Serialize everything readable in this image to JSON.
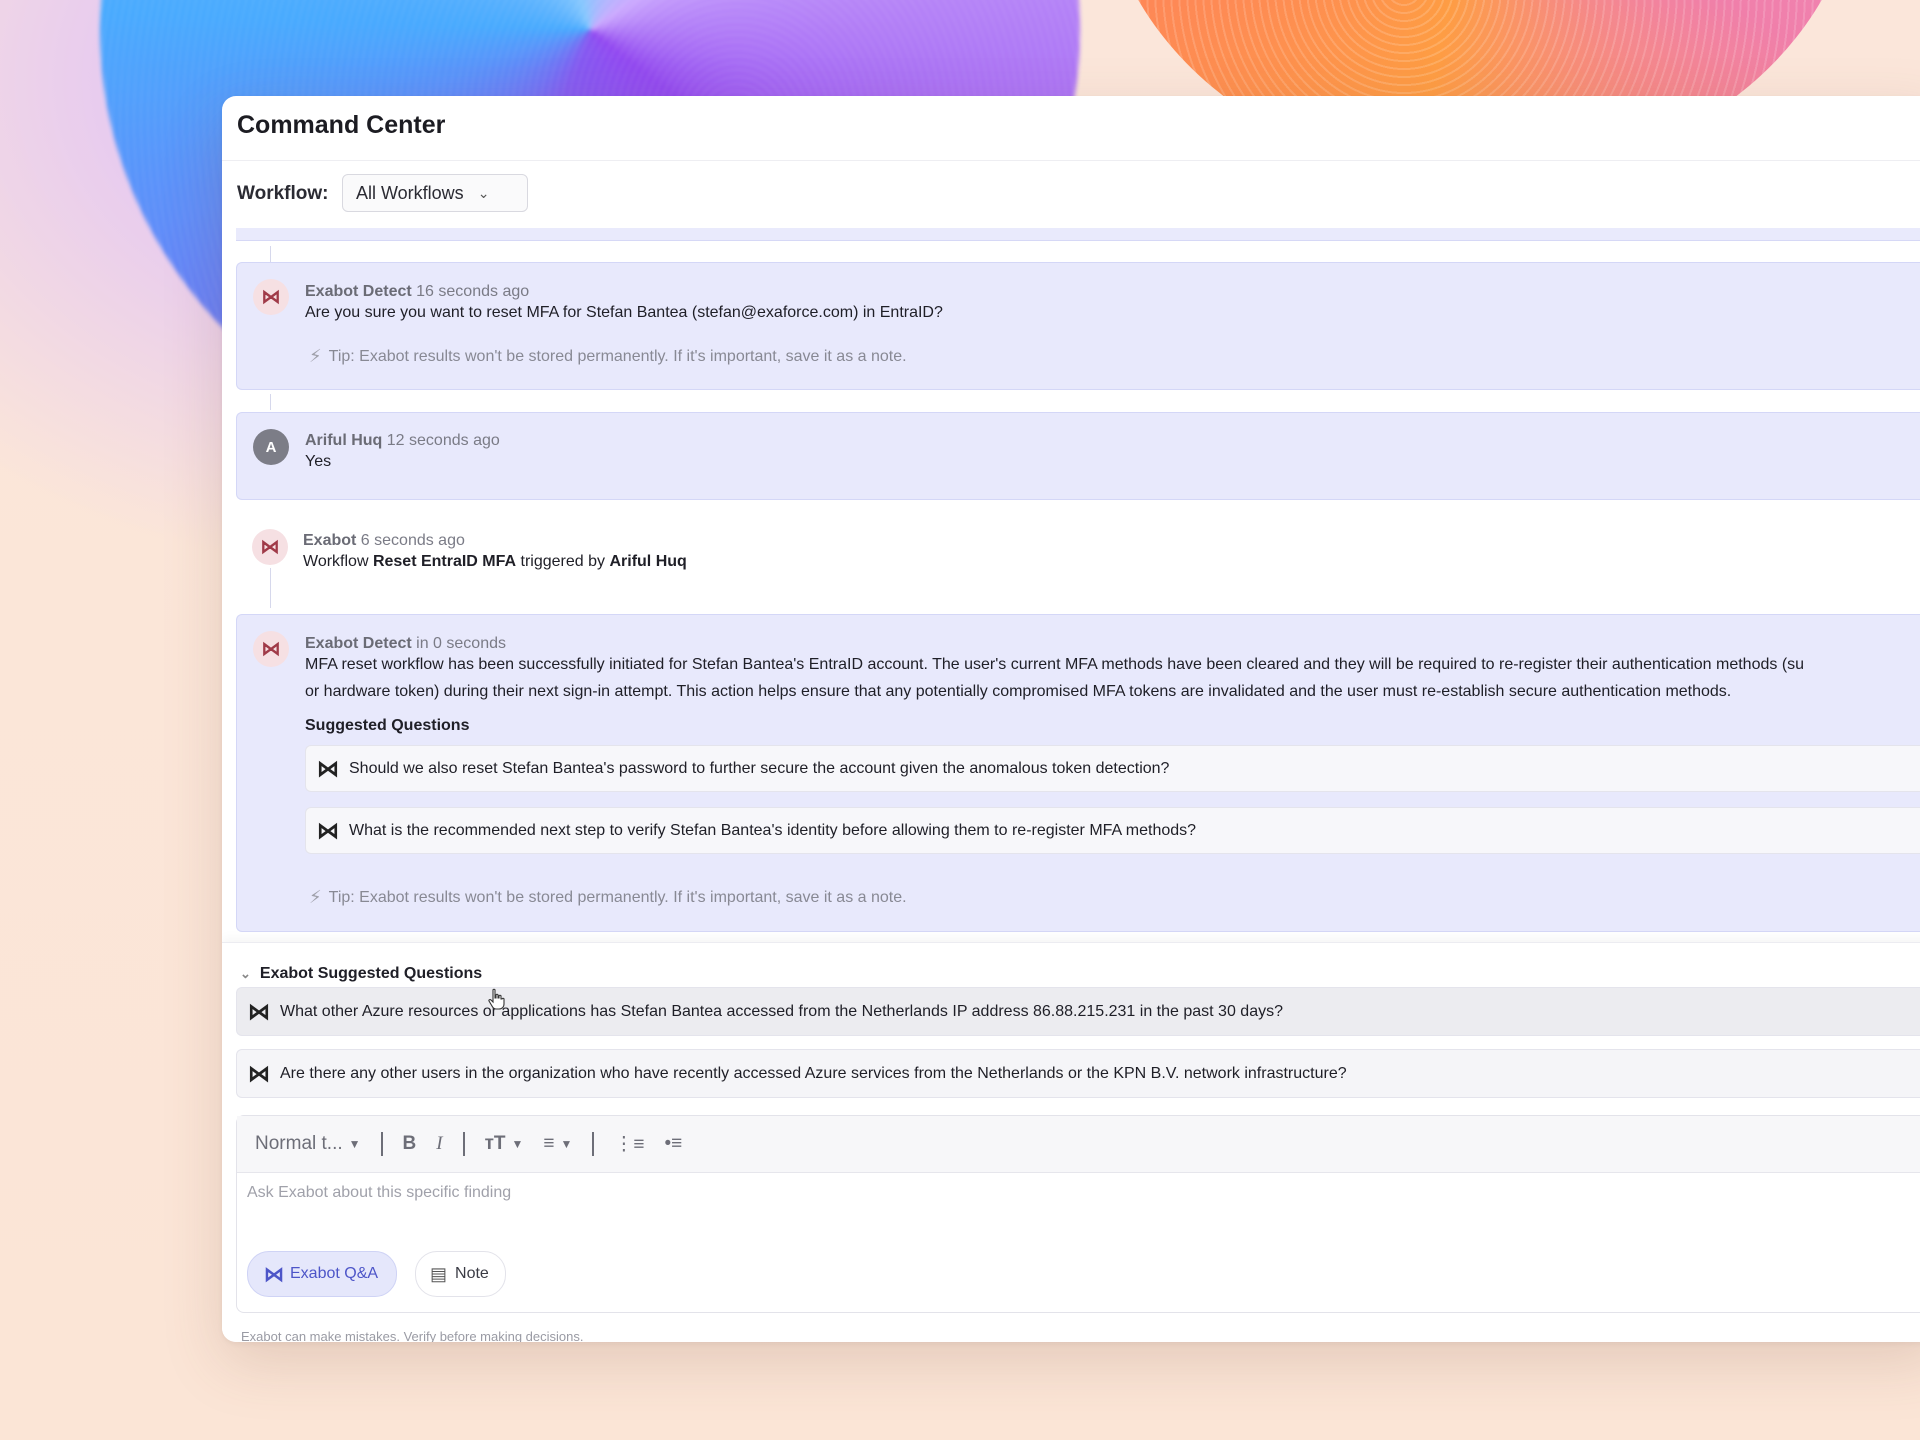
{
  "header": {
    "title": "Command Center",
    "workflow_label": "Workflow:",
    "workflow_value": "All Workflows"
  },
  "messages": [
    {
      "author": "Exabot Detect",
      "time": "16 seconds ago",
      "text": "Are you sure you want to reset MFA for Stefan Bantea (stefan@exaforce.com) in EntraID?",
      "tip": "Tip: Exabot results won't be stored permanently. If it's important, save it as a note."
    },
    {
      "author": "Ariful Huq",
      "avatar_letter": "A",
      "time": "12 seconds ago",
      "text": "Yes"
    },
    {
      "author": "Exabot",
      "time": "6 seconds ago",
      "text_prefix": "Workflow ",
      "workflow_name": "Reset EntraID MFA",
      "text_middle": " triggered by ",
      "trigger_user": "Ariful Huq"
    },
    {
      "author": "Exabot Detect",
      "time": "in 0 seconds",
      "line1": "MFA reset workflow has been successfully initiated for Stefan Bantea's EntraID account. The user's current MFA methods have been cleared and they will be required to re-register their authentication methods (su",
      "line2": "or hardware token) during their next sign-in attempt. This action helps ensure that any potentially compromised MFA tokens are invalidated and the user must re-establish secure authentication methods.",
      "suggested_title": "Suggested Questions",
      "suggested": [
        "Should we also reset Stefan Bantea's password to further secure the account given the anomalous token detection?",
        "What is the recommended next step to verify Stefan Bantea's identity before allowing them to re-register MFA methods?"
      ],
      "tip": "Tip: Exabot results won't be stored permanently. If it's important, save it as a note."
    }
  ],
  "suggestions": {
    "title": "Exabot Suggested Questions",
    "items": [
      "What other Azure resources or applications has Stefan Bantea accessed from the Netherlands IP address 86.88.215.231 in the past 30 days?",
      "Are there any other users in the organization who have recently accessed Azure services from the Netherlands or the KPN B.V. network infrastructure?"
    ]
  },
  "editor": {
    "style_select": "Normal t...",
    "bold": "B",
    "italic": "I",
    "placeholder": "Ask Exabot about this specific finding",
    "qa_button": "Exabot Q&A",
    "note_button": "Note",
    "disclaimer": "Exabot can make mistakes. Verify before making decisions."
  },
  "icons": {
    "exabot": "exabot-bowtie-icon",
    "tip": "lightning-bolt-icon",
    "note": "document-icon",
    "text_size": "text-size-icon",
    "align": "align-left-icon",
    "ordered_list": "ordered-list-icon",
    "bullet_list": "bullet-list-icon"
  },
  "colors": {
    "accent": "#4d55c8",
    "highlight_bg": "#e8e9fc",
    "avatar_bg": "#f6e0e3"
  }
}
